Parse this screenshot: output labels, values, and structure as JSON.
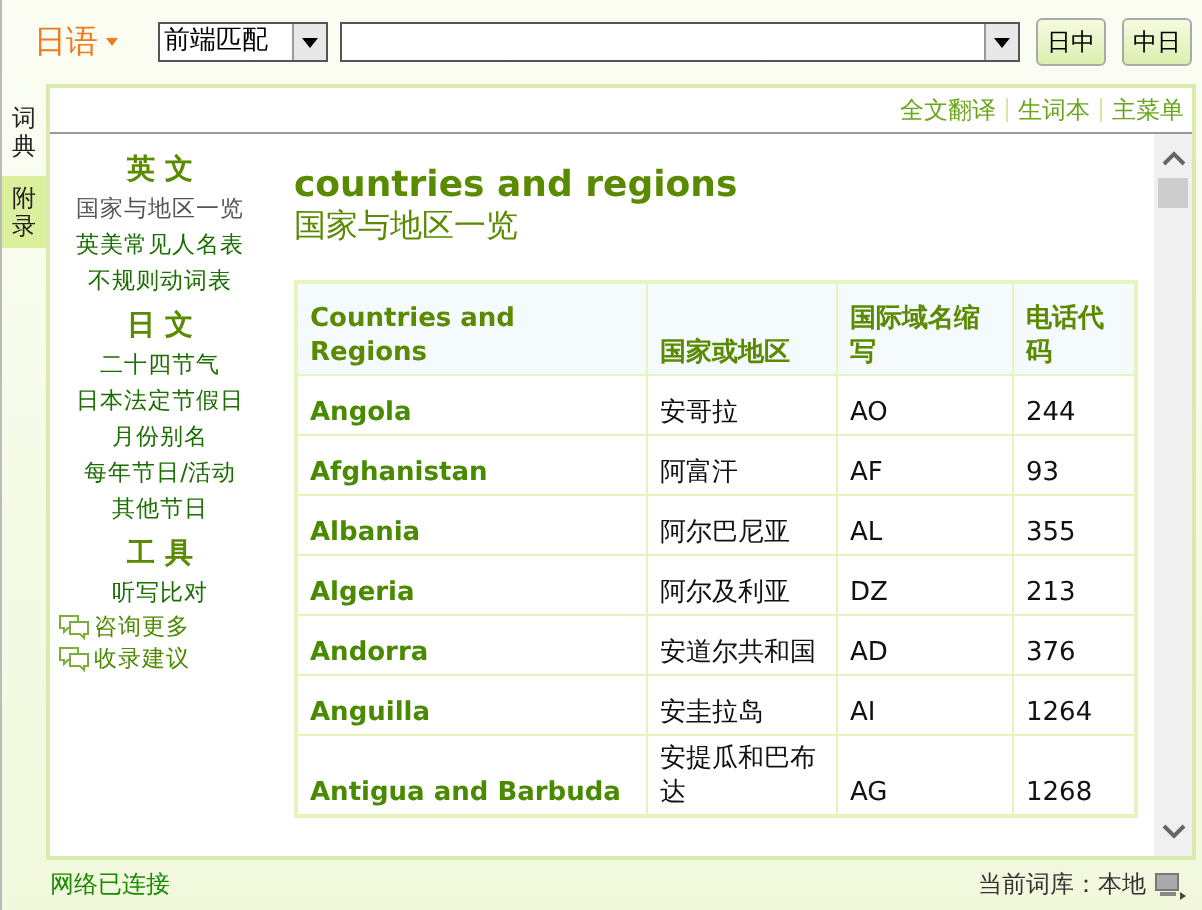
{
  "toolbar": {
    "language": "日语",
    "match_mode": "前端匹配",
    "buttons": [
      "日中",
      "中日"
    ]
  },
  "side_tabs": [
    {
      "label": "词典",
      "selected": false
    },
    {
      "label": "附录",
      "selected": true
    }
  ],
  "top_links": [
    "全文翻译",
    "生词本",
    "主菜单"
  ],
  "sidebar": [
    {
      "heading": "英 文",
      "items": [
        {
          "label": "国家与地区一览",
          "selected": true
        },
        {
          "label": "英美常见人名表",
          "selected": false
        },
        {
          "label": "不规则动词表",
          "selected": false
        }
      ]
    },
    {
      "heading": "日 文",
      "items": [
        {
          "label": "二十四节气",
          "selected": false
        },
        {
          "label": "日本法定节假日",
          "selected": false
        },
        {
          "label": "月份别名",
          "selected": false
        },
        {
          "label": "每年节日/活动",
          "selected": false
        },
        {
          "label": "其他节日",
          "selected": false
        }
      ]
    },
    {
      "heading": "工 具",
      "items": [
        {
          "label": "听写比对",
          "selected": false
        }
      ]
    }
  ],
  "sidebar_links": [
    "咨询更多",
    "收录建议"
  ],
  "content": {
    "title": "countries and regions",
    "subtitle": "国家与地区一览",
    "table": {
      "columns": [
        "Countries and Regions",
        "国家或地区",
        "国际域名缩写",
        "电话代码"
      ],
      "rows": [
        [
          "Angola",
          "安哥拉",
          "AO",
          "244"
        ],
        [
          "Afghanistan",
          "阿富汗",
          "AF",
          "93"
        ],
        [
          "Albania",
          "阿尔巴尼亚",
          "AL",
          "355"
        ],
        [
          "Algeria",
          "阿尔及利亚",
          "DZ",
          "213"
        ],
        [
          "Andorra",
          "安道尔共和国",
          "AD",
          "376"
        ],
        [
          "Anguilla",
          "安圭拉岛",
          "AI",
          "1264"
        ],
        [
          "Antigua and Barbuda",
          "安提瓜和巴布达",
          "AG",
          "1268"
        ]
      ]
    }
  },
  "status_bar": {
    "connection": "网络已连接",
    "library": "当前词库：本地"
  }
}
